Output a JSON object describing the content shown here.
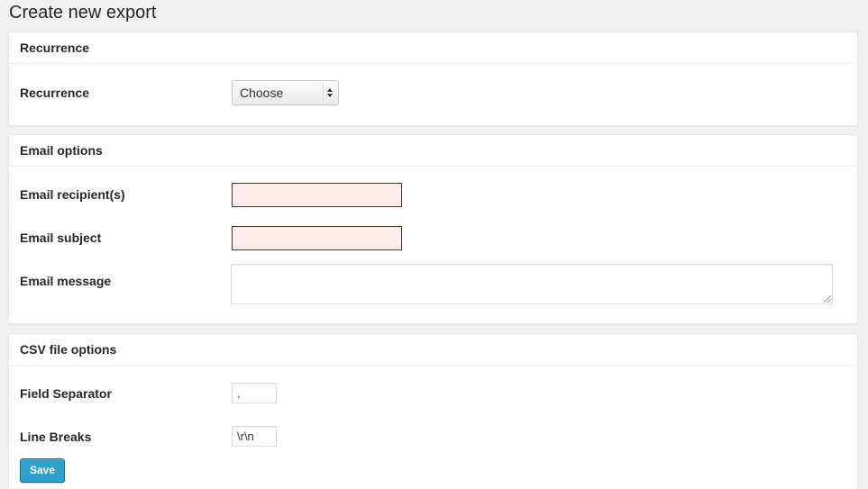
{
  "page": {
    "title": "Create new export"
  },
  "recurrence_panel": {
    "header": "Recurrence",
    "label": "Recurrence",
    "select_value": "Choose"
  },
  "email_panel": {
    "header": "Email options",
    "recipients_label": "Email recipient(s)",
    "recipients_value": "",
    "subject_label": "Email subject",
    "subject_value": "",
    "message_label": "Email message",
    "message_value": ""
  },
  "csv_panel": {
    "header": "CSV file options",
    "separator_label": "Field Separator",
    "separator_value": ",",
    "linebreaks_label": "Line Breaks",
    "linebreaks_value": "\\r\\n"
  },
  "actions": {
    "save_label": "Save"
  },
  "colors": {
    "accent": "#2ea2cc",
    "error_background": "#ffebe8",
    "error_border": "#cc0000"
  }
}
